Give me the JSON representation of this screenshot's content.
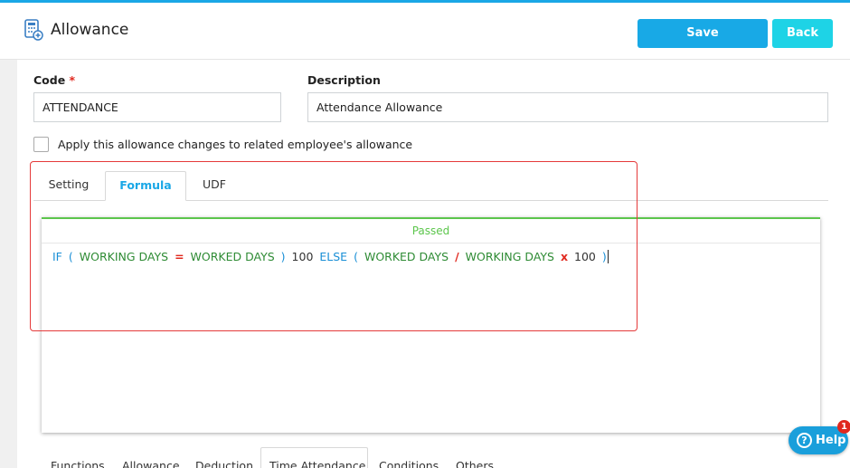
{
  "header": {
    "title": "Allowance",
    "save_label": "Save",
    "back_label": "Back",
    "icon": "allowance-icon"
  },
  "form": {
    "code_label": "Code",
    "code_required": "*",
    "code_value": "ATTENDANCE",
    "description_label": "Description",
    "description_value": "Attendance Allowance",
    "apply_checkbox_label": "Apply this allowance changes to related employee's allowance",
    "apply_checked": false
  },
  "tabs": [
    {
      "label": "Setting",
      "active": false
    },
    {
      "label": "Formula",
      "active": true
    },
    {
      "label": "UDF",
      "active": false
    }
  ],
  "editor": {
    "status": "Passed",
    "formula": [
      {
        "text": "IF",
        "kind": "keyword"
      },
      {
        "text": "(",
        "kind": "paren"
      },
      {
        "text": "WORKING DAYS",
        "kind": "field"
      },
      {
        "text": "=",
        "kind": "operator"
      },
      {
        "text": "WORKED DAYS",
        "kind": "field"
      },
      {
        "text": ")",
        "kind": "paren"
      },
      {
        "text": "100",
        "kind": "number"
      },
      {
        "text": "ELSE",
        "kind": "keyword"
      },
      {
        "text": "(",
        "kind": "paren"
      },
      {
        "text": "WORKED DAYS",
        "kind": "field"
      },
      {
        "text": "/",
        "kind": "operator"
      },
      {
        "text": "WORKING DAYS",
        "kind": "field"
      },
      {
        "text": "x",
        "kind": "operator"
      },
      {
        "text": "100",
        "kind": "number"
      },
      {
        "text": ")",
        "kind": "paren"
      }
    ]
  },
  "bottom_tabs": [
    {
      "label": "Functions",
      "active": false
    },
    {
      "label": "Allowance",
      "active": false
    },
    {
      "label": "Deduction",
      "active": false
    },
    {
      "label": "Time Attendance",
      "active": true
    },
    {
      "label": "Conditions",
      "active": false
    },
    {
      "label": "Others",
      "active": false
    }
  ],
  "help": {
    "label": "Help",
    "badge_count": "1"
  },
  "colors": {
    "accent": "#1aa7e6",
    "back_button": "#1ed3e6",
    "passed": "#5cc64c",
    "highlight_box": "#e53a3a"
  }
}
